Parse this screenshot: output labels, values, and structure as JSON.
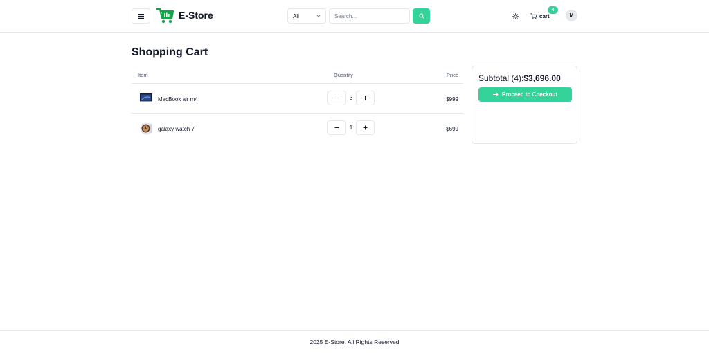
{
  "header": {
    "brand": "E-Store",
    "category": {
      "selected": "All"
    },
    "search": {
      "placeholder": "Search..."
    },
    "cart": {
      "label": "cart",
      "count": "4"
    },
    "user": {
      "initial": "M"
    }
  },
  "cart_page": {
    "title": "Shopping Cart",
    "columns": {
      "item": "Item",
      "quantity": "Quantity",
      "price": "Price"
    },
    "items": [
      {
        "name": "MacBook air m4",
        "quantity": "3",
        "price": "$999",
        "thumbnail": "laptop-thumbnail"
      },
      {
        "name": "galaxy watch 7",
        "quantity": "1",
        "price": "$699",
        "thumbnail": "watch-thumbnail"
      }
    ],
    "summary": {
      "subtotal_label": "Subtotal (4):",
      "subtotal_value": "$3,696.00",
      "checkout_label": "Proceed to Checkout"
    }
  },
  "footer": {
    "text": "2025 E-Store. All Rights Reserved"
  },
  "colors": {
    "accent": "#34d399",
    "border": "#e5e7eb",
    "text": "#111827"
  }
}
